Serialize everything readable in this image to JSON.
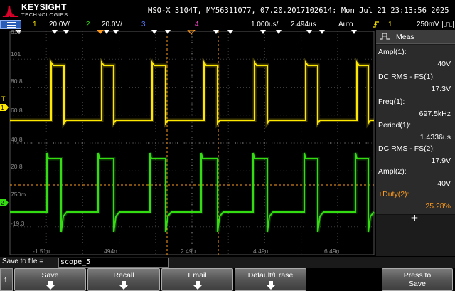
{
  "header": {
    "brand": "KEYSIGHT",
    "brand_sub": "TECHNOLOGIES",
    "device_info": "MSO-X 3104T, MY56311077, 07.20.2017102614: Mon Jul 21 23:13:56 2025"
  },
  "status_bar": {
    "ch1_num": "1",
    "ch1_scale": "20.0V/",
    "ch2_num": "2",
    "ch2_scale": "20.0V/",
    "ch3_num": "3",
    "ch4_num": "4",
    "timebase": "1.000us/",
    "delay": "2.494us",
    "mode": "Auto",
    "trig_icon": "rising-edge-trigger",
    "trig_source": "1",
    "trig_level": "250mV",
    "colors": {
      "ch1": "#ffe800",
      "ch2": "#33dd11",
      "ch3": "#5577ff",
      "ch4": "#ff44cc"
    }
  },
  "graticule": {
    "y_labels": [
      "61V",
      "101",
      "80.8",
      "60.8",
      "40.8",
      "20.8",
      "750m",
      "-19.3"
    ],
    "x_labels": [
      "-1.51u",
      "494n",
      "2.49u",
      "4.49u",
      "6.49u"
    ]
  },
  "meas_panel": {
    "title": "Meas",
    "items": [
      {
        "label": "Ampl(1):",
        "value": "40V"
      },
      {
        "label": "DC RMS - FS(1):",
        "value": "17.3V"
      },
      {
        "label": "Freq(1):",
        "value": "697.5kHz"
      },
      {
        "label": "Period(1):",
        "value": "1.4336us"
      },
      {
        "label": "DC RMS - FS(2):",
        "value": "17.9V"
      },
      {
        "label": "Ampl(2):",
        "value": "40V"
      },
      {
        "label": "+Duty(2):",
        "value": "25.28%"
      }
    ],
    "add_symbol": "+"
  },
  "save_bar": {
    "label": "Save to file =",
    "filename": "scope_5"
  },
  "softkeys": {
    "back": "↑",
    "save": "Save",
    "recall": "Recall",
    "email": "Email",
    "default_erase": "Default/Erase",
    "press_to_save": "Press to\nSave"
  }
}
